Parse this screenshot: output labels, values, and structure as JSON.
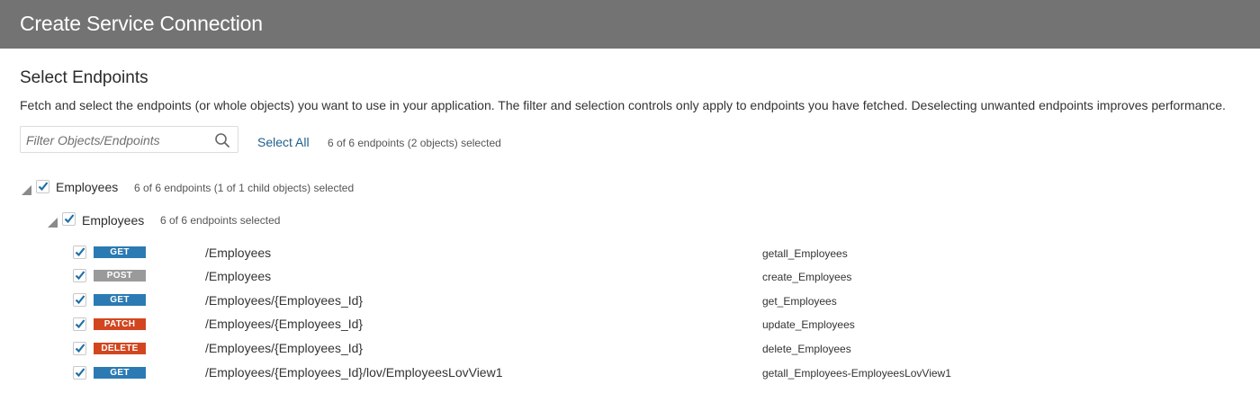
{
  "header": {
    "title": "Create Service Connection"
  },
  "section": {
    "title": "Select Endpoints",
    "description": "Fetch and select the endpoints (or whole objects) you want to use in your application. The filter and selection controls only apply to endpoints you have fetched. Deselecting unwanted endpoints improves performance."
  },
  "toolbar": {
    "filter_placeholder": "Filter Objects/Endpoints",
    "filter_value": "",
    "select_all_label": "Select All",
    "summary": "6 of 6 endpoints (2 objects) selected"
  },
  "tree": {
    "root": {
      "label": "Employees",
      "count": "6 of 6 endpoints (1 of 1 child objects) selected",
      "checked": true,
      "expanded": true
    },
    "child": {
      "label": "Employees",
      "count": "6 of 6 endpoints selected",
      "checked": true,
      "expanded": true
    }
  },
  "endpoints": [
    {
      "method": "GET",
      "method_color": "#2b7ab3",
      "path": "/Employees",
      "operation": "getall_Employees",
      "checked": true
    },
    {
      "method": "POST",
      "method_color": "#9a9a9a",
      "path": "/Employees",
      "operation": "create_Employees",
      "checked": true
    },
    {
      "method": "GET",
      "method_color": "#2b7ab3",
      "path": "/Employees/{Employees_Id}",
      "operation": "get_Employees",
      "checked": true
    },
    {
      "method": "PATCH",
      "method_color": "#d2461f",
      "path": "/Employees/{Employees_Id}",
      "operation": "update_Employees",
      "checked": true
    },
    {
      "method": "DELETE",
      "method_color": "#d2461f",
      "path": "/Employees/{Employees_Id}",
      "operation": "delete_Employees",
      "checked": true
    },
    {
      "method": "GET",
      "method_color": "#2b7ab3",
      "path": "/Employees/{Employees_Id}/lov/EmployeesLovView1",
      "operation": "getall_Employees-EmployeesLovView1",
      "checked": true
    }
  ],
  "icons": {
    "search": "search-icon",
    "tree_toggle": "triangle-expanded-icon",
    "checkbox": "checkmark-icon"
  },
  "colors": {
    "header_bg": "#737373",
    "link": "#1f5f8b",
    "check": "#1f6fa6",
    "get": "#2b7ab3",
    "post": "#9a9a9a",
    "patch": "#d2461f",
    "delete": "#d2461f"
  }
}
